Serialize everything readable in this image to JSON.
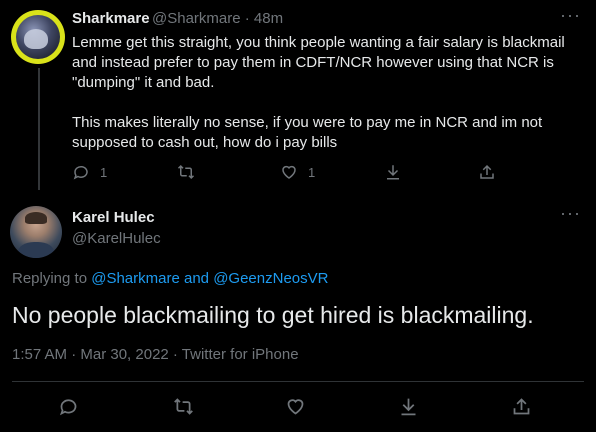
{
  "tweet1": {
    "display_name": "Sharkmare",
    "handle": "@Sharkmare",
    "time": " · 48m",
    "paragraph1": "Lemme get this straight, you think people wanting a fair salary is blackmail and instead prefer to pay them in CDFT/NCR however using that NCR is \"dumping\" it and bad.",
    "paragraph2": "This makes literally no sense, if you were to pay me in NCR and im not supposed to cash out, how do i pay bills",
    "reply_count": "1",
    "like_count": "1",
    "icons": [
      "reply-icon",
      "retweet-icon",
      "like-icon",
      "download-icon",
      "share-icon"
    ]
  },
  "tweet2": {
    "display_name": "Karel Hulec",
    "handle": "@KarelHulec",
    "replying_prefix": "Replying to ",
    "replying_user1": "@Sharkmare",
    "replying_and": " and ",
    "replying_user2": "@GeenzNeosVR",
    "text": "No people blackmailing to get hired is blackmailing.",
    "timestamp": "1:57 AM · Mar 30, 2022 · Twitter for iPhone",
    "icons": [
      "reply-icon",
      "retweet-icon",
      "like-icon",
      "download-icon",
      "share-icon"
    ]
  },
  "more_label": "···",
  "colors": {
    "background": "#000000",
    "text": "#e7e9ea",
    "muted": "#71767b",
    "link": "#1d9bf0",
    "divider": "#2f3336",
    "avatar_ring": "#d9e21a"
  }
}
